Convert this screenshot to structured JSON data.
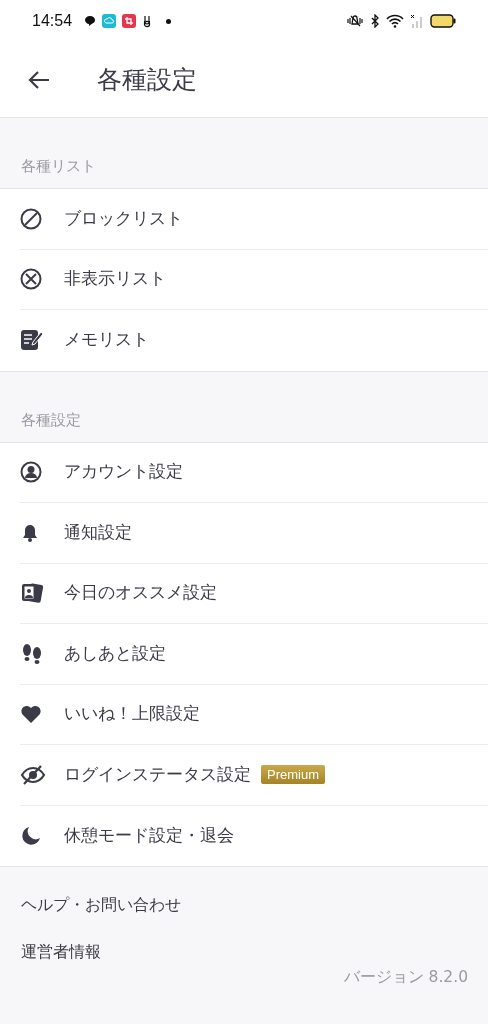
{
  "status_bar": {
    "time": "14:54"
  },
  "header": {
    "title": "各種設定"
  },
  "sections": [
    {
      "title": "各種リスト",
      "items": [
        {
          "label": "ブロックリスト"
        },
        {
          "label": "非表示リスト"
        },
        {
          "label": "メモリスト"
        }
      ]
    },
    {
      "title": "各種設定",
      "items": [
        {
          "label": "アカウント設定"
        },
        {
          "label": "通知設定"
        },
        {
          "label": "今日のオススメ設定"
        },
        {
          "label": "あしあと設定"
        },
        {
          "label": "いいね！上限設定"
        },
        {
          "label": "ログインステータス設定",
          "badge": "Premium"
        },
        {
          "label": "休憩モード設定・退会"
        }
      ]
    }
  ],
  "footer": {
    "links": [
      "ヘルプ・お問い合わせ",
      "運営者情報"
    ],
    "version": "バージョン 8.2.0"
  }
}
